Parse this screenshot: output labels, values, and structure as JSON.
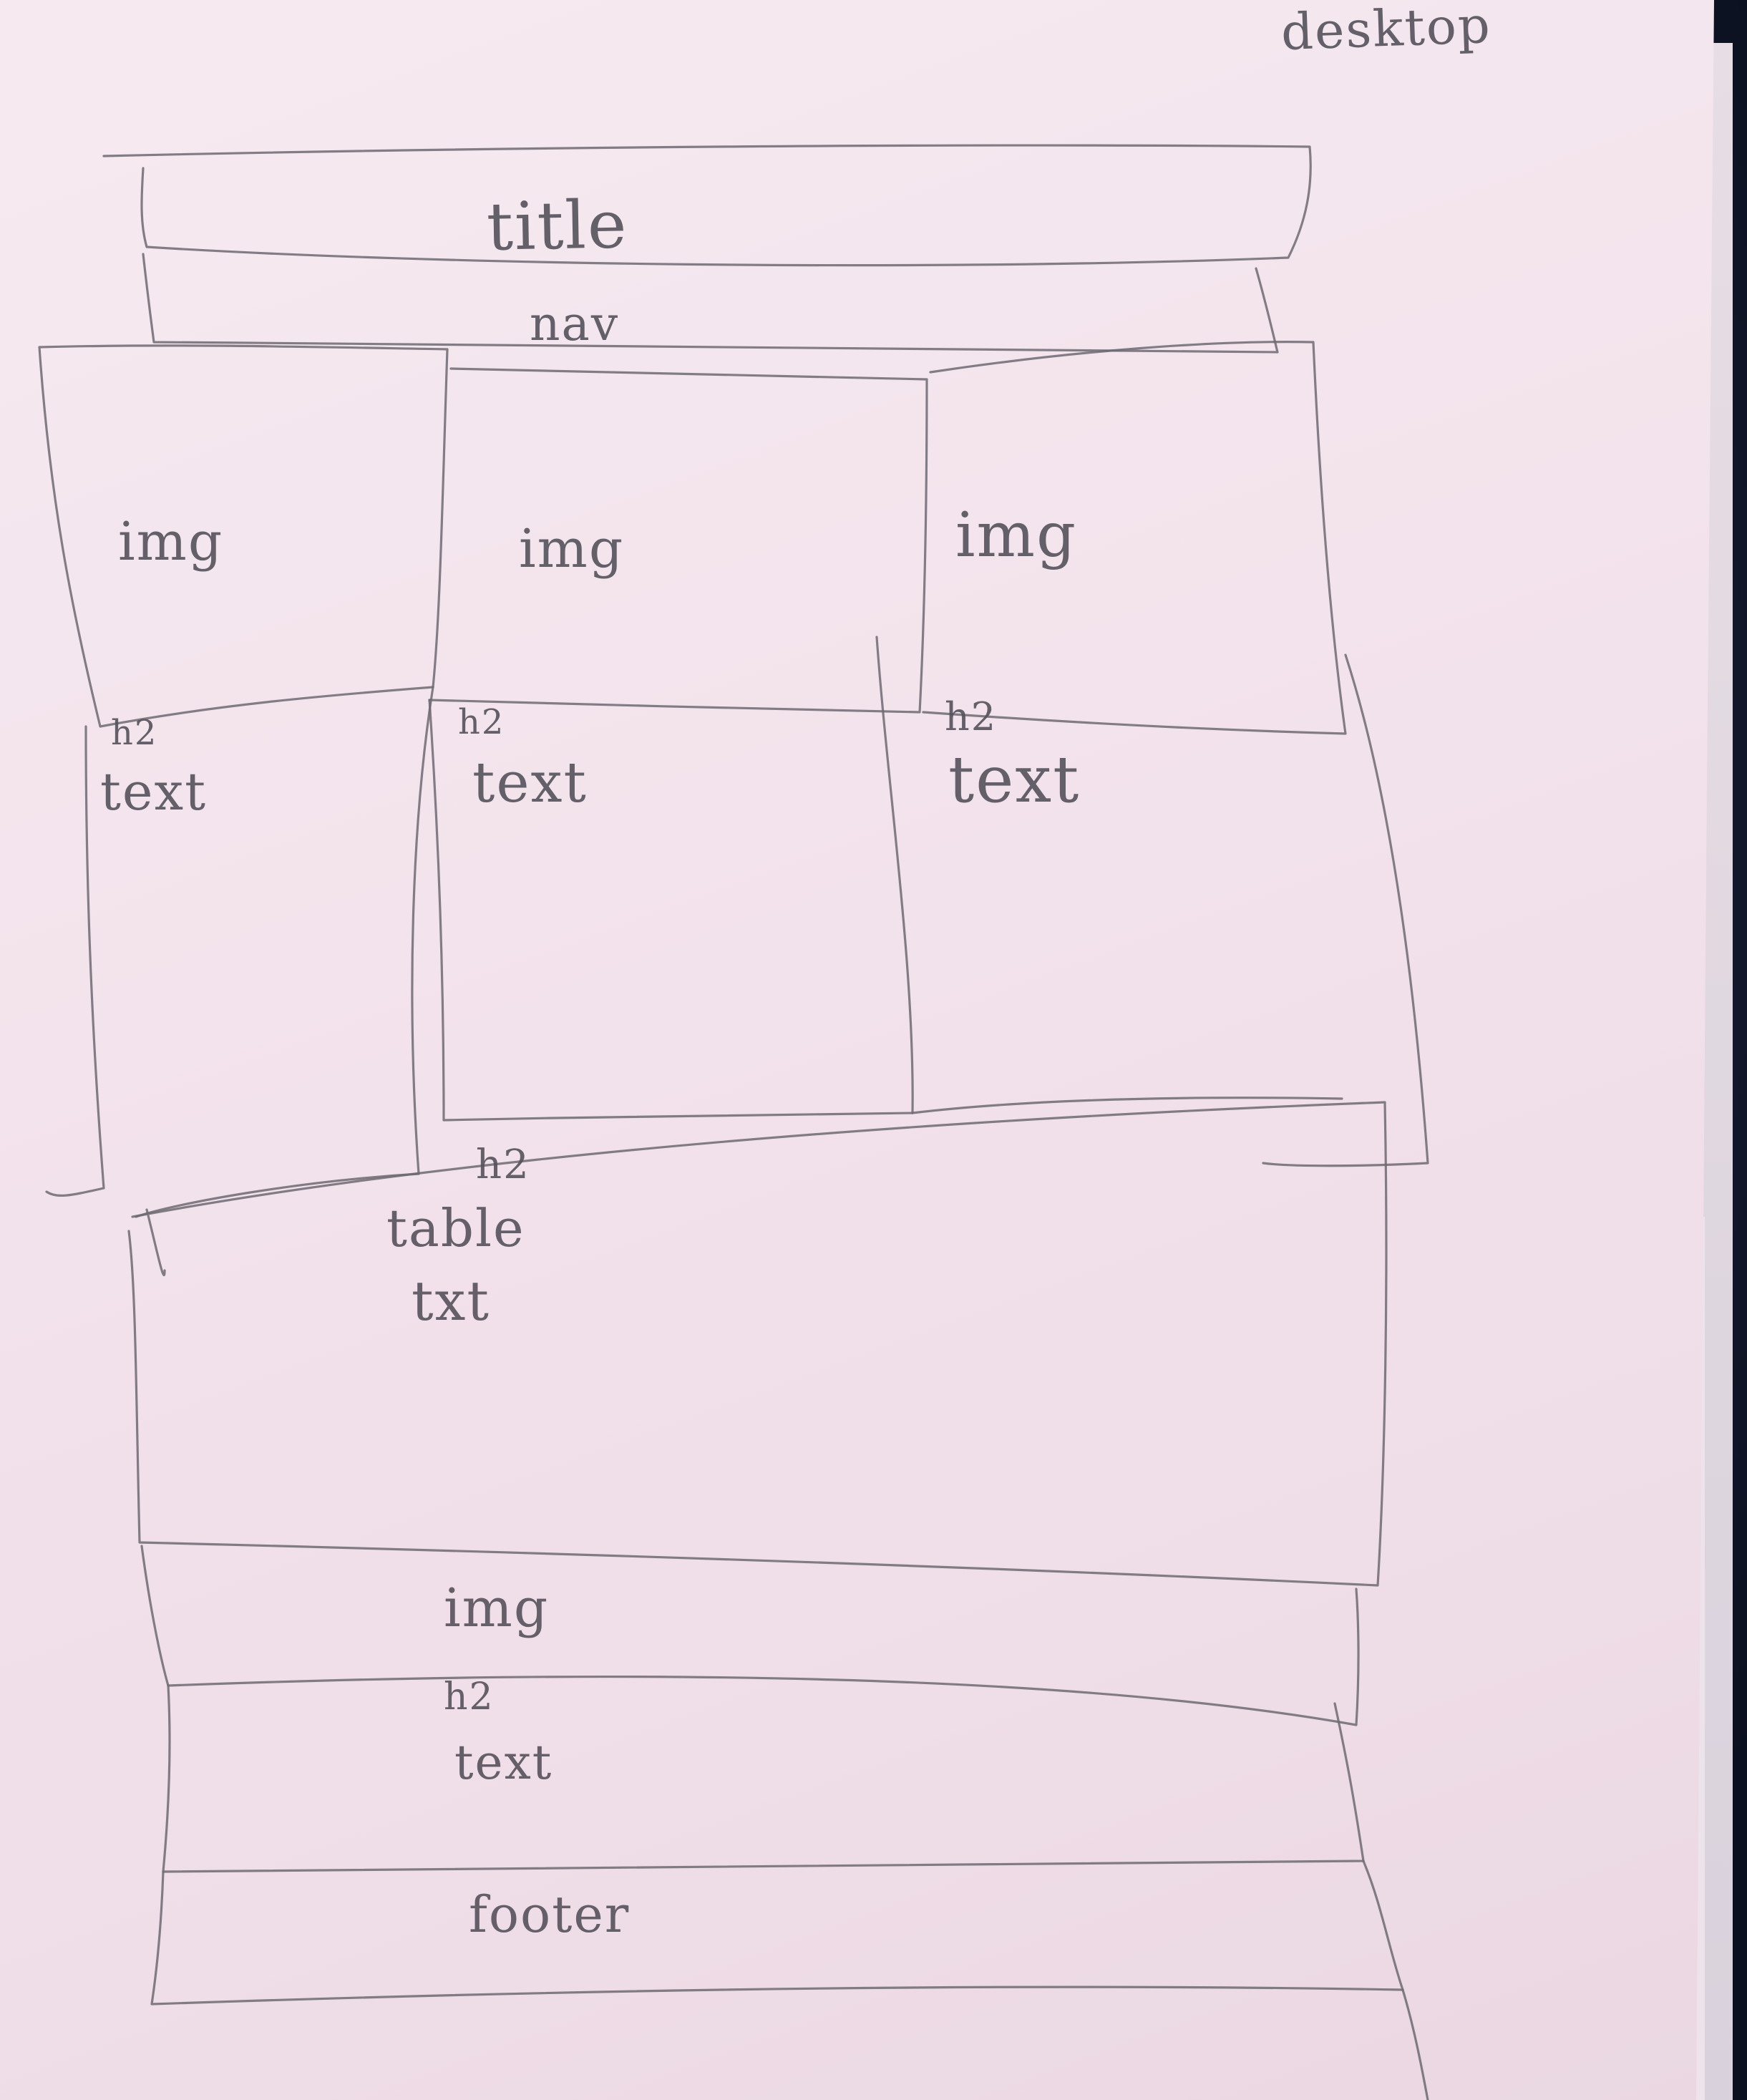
{
  "annotation": "desktop",
  "labels": {
    "title": "title",
    "nav": "nav",
    "img_1": "img",
    "img_2": "img",
    "img_3": "img",
    "h2_1": "h2",
    "text_1": "text",
    "h2_2": "h2",
    "text_2": "text",
    "h2_3": "h2",
    "text_3": "text",
    "h2_4": "h2",
    "table": "table",
    "txt": "txt",
    "img_4": "img",
    "h2_5": "h2",
    "text_5": "text",
    "footer": "footer"
  }
}
